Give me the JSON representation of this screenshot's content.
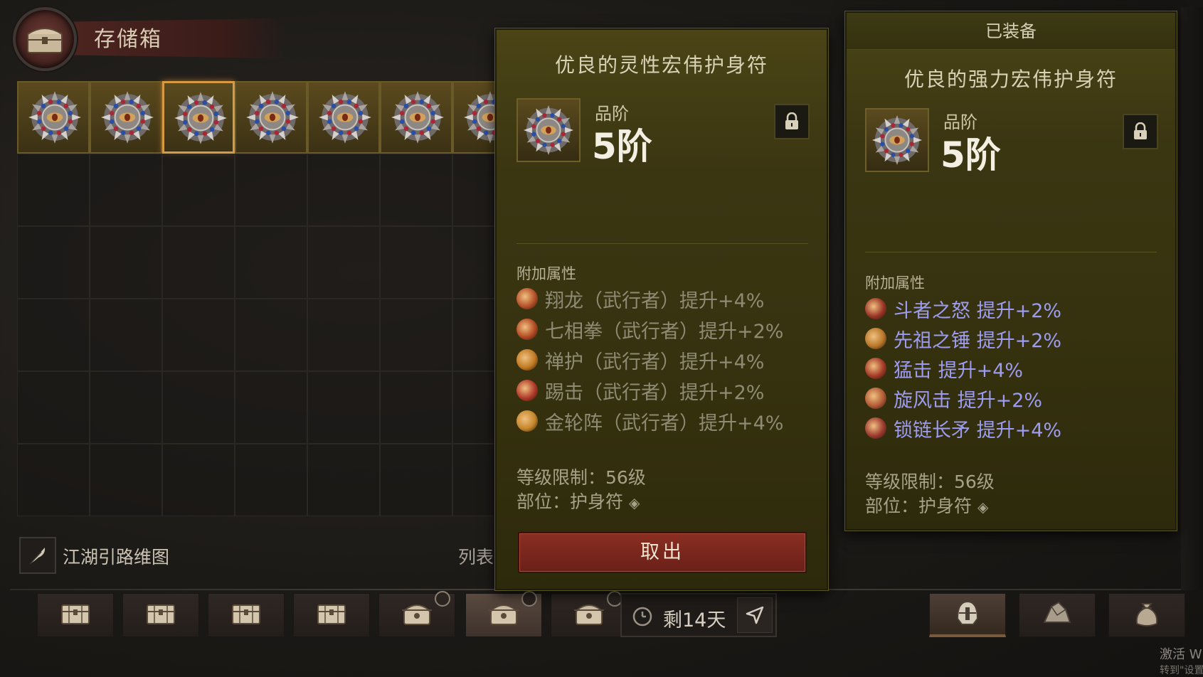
{
  "header": {
    "title": "存储箱",
    "emblem_icon": "chest-icon"
  },
  "grid": {
    "filled_count": 7,
    "selected_index": 2,
    "item_icon": "amulet-icon"
  },
  "guide": {
    "label": "江湖引路维图",
    "icon": "feather-icon"
  },
  "list_label": "列表",
  "tabs": [
    {
      "icon": "chest-icon",
      "timer": false
    },
    {
      "icon": "chest-icon",
      "timer": false
    },
    {
      "icon": "chest-icon",
      "timer": false
    },
    {
      "icon": "chest-icon",
      "timer": false
    },
    {
      "icon": "ornate-chest-icon",
      "timer": true
    },
    {
      "icon": "ornate-chest-icon",
      "timer": true,
      "active": true
    },
    {
      "icon": "ornate-chest-icon",
      "timer": true
    }
  ],
  "timer": {
    "text": "剩14天"
  },
  "right_tabs": [
    {
      "icon": "helmet-icon",
      "active": true
    },
    {
      "icon": "material-icon"
    },
    {
      "icon": "bag-icon"
    }
  ],
  "left_item": {
    "name": "优良的灵性宏伟护身符",
    "rank_label": "品阶",
    "rank_value": "5阶",
    "section_title": "附加属性",
    "affixes": [
      {
        "text": "翔龙（武行者）提升+4%",
        "color": "#b5512a"
      },
      {
        "text": "七相拳（武行者）提升+2%",
        "color": "#b34a24"
      },
      {
        "text": "禅护（武行者）提升+4%",
        "color": "#c07a22"
      },
      {
        "text": "踢击（武行者）提升+2%",
        "color": "#b03a2a"
      },
      {
        "text": "金轮阵（武行者）提升+4%",
        "color": "#c4862a"
      }
    ],
    "level_req": "等级限制：56级",
    "slot": "部位：护身符",
    "take_button": "取出"
  },
  "right_item": {
    "banner": "已装备",
    "name": "优良的强力宏伟护身符",
    "rank_label": "品阶",
    "rank_value": "5阶",
    "section_title": "附加属性",
    "affixes": [
      {
        "text": "斗者之怒  提升+2%",
        "color": "#9a3526"
      },
      {
        "text": "先祖之锤  提升+2%",
        "color": "#b8772a"
      },
      {
        "text": "猛击  提升+4%",
        "color": "#a43a28"
      },
      {
        "text": "旋风击  提升+2%",
        "color": "#b25a36"
      },
      {
        "text": "锁链长矛  提升+4%",
        "color": "#9c3a30"
      }
    ],
    "level_req": "等级限制：56级",
    "slot": "部位：护身符"
  },
  "watermark": {
    "line1": "激活 W",
    "line2": "转到\"设置"
  }
}
